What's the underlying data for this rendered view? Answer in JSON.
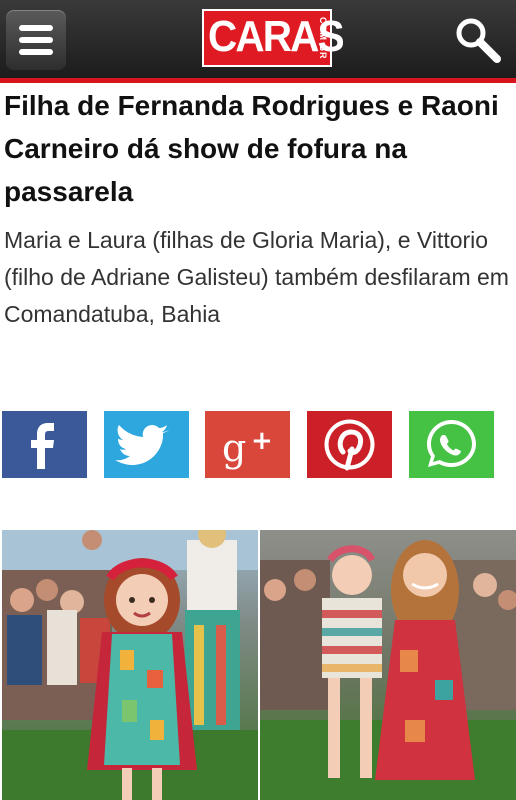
{
  "header": {
    "logo_text": "CARAS",
    "logo_sub": "COM BR",
    "menu_icon": "hamburger-menu-icon",
    "search_icon": "search-icon",
    "accent_color": "#d8141c"
  },
  "article": {
    "headline": "Filha de Fernanda Rodrigues e Raoni Carneiro dá show de fofura na passarela",
    "subtitle": "Maria e Laura (filhas de Gloria Maria), e Vittorio (filho de Adriane Galisteu) também desfilaram em Comandatuba, Bahia"
  },
  "share": {
    "buttons": [
      {
        "icon": "facebook-icon",
        "color": "#3b5998"
      },
      {
        "icon": "twitter-icon",
        "color": "#2ea7df"
      },
      {
        "icon": "google-plus-icon",
        "color": "#d9473a"
      },
      {
        "icon": "pinterest-icon",
        "color": "#cb2027"
      },
      {
        "icon": "whatsapp-icon",
        "color": "#45c144"
      }
    ]
  },
  "photos": [
    {
      "subject": "girl with red headband and patterned dress on runway"
    },
    {
      "subject": "girl in striped top with woman in red patterned dress on runway"
    }
  ]
}
